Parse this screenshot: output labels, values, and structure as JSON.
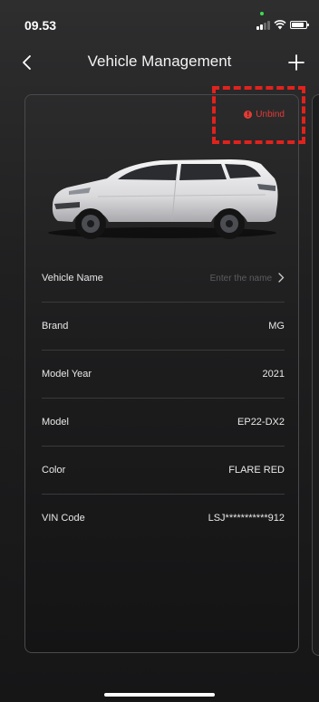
{
  "status_bar": {
    "time": "09.53"
  },
  "header": {
    "title": "Vehicle Management"
  },
  "card": {
    "unbind_label": "Unbind",
    "rows": [
      {
        "label": "Vehicle Name",
        "placeholder": "Enter the name"
      },
      {
        "label": "Brand",
        "value": "MG"
      },
      {
        "label": "Model Year",
        "value": "2021"
      },
      {
        "label": "Model",
        "value": "EP22-DX2"
      },
      {
        "label": "Color",
        "value": "FLARE RED"
      },
      {
        "label": "VIN Code",
        "value": "LSJ***********912"
      }
    ]
  },
  "colors": {
    "accent_red": "#e43b36",
    "highlight_red": "#e0221d",
    "background": "#1f1f20"
  },
  "icons": [
    "back-icon",
    "plus-icon",
    "alert-icon",
    "chevron-right-icon",
    "car-image",
    "signal-icon",
    "wifi-icon",
    "battery-icon"
  ]
}
